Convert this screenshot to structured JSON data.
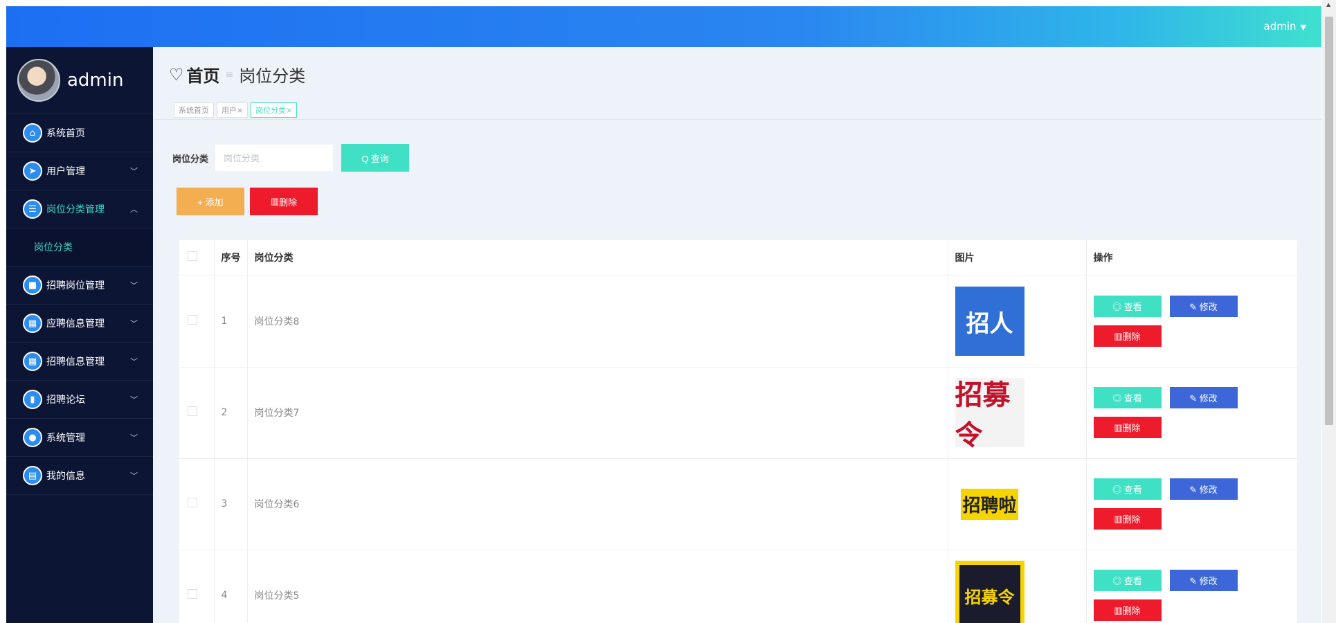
{
  "topbar": {
    "user": "admin"
  },
  "sidebar": {
    "brand": "admin",
    "items": [
      {
        "label": "系统首页",
        "icon": "home-icon",
        "glyph": "⌂",
        "arrow": ""
      },
      {
        "label": "用户管理",
        "icon": "send-icon",
        "glyph": "➤",
        "arrow": "﹀"
      },
      {
        "label": "岗位分类管理",
        "icon": "list-icon",
        "glyph": "☰",
        "arrow": "︿"
      },
      {
        "label": "招聘岗位管理",
        "icon": "briefcase-icon",
        "glyph": "■",
        "arrow": "﹀"
      },
      {
        "label": "应聘信息管理",
        "icon": "grid-icon",
        "glyph": "▦",
        "arrow": "﹀"
      },
      {
        "label": "招聘信息管理",
        "icon": "grid-icon",
        "glyph": "▦",
        "arrow": "﹀"
      },
      {
        "label": "招聘论坛",
        "icon": "chart-icon",
        "glyph": "▮",
        "arrow": "﹀"
      },
      {
        "label": "系统管理",
        "icon": "user-icon",
        "glyph": "●",
        "arrow": "﹀"
      },
      {
        "label": "我的信息",
        "icon": "card-icon",
        "glyph": "▤",
        "arrow": "﹀"
      }
    ],
    "submenu": "岗位分类"
  },
  "header": {
    "home": "首页",
    "separator": "≡",
    "current": "岗位分类",
    "tabs": [
      "系统首页",
      "用户×",
      "岗位分类×"
    ]
  },
  "search": {
    "label": "岗位分类",
    "placeholder": "岗位分类",
    "button": "Q 查询"
  },
  "actions": {
    "add": "+ 添加",
    "delete": "删除"
  },
  "table": {
    "headers": {
      "no": "序号",
      "name": "岗位分类",
      "image": "图片",
      "ops": "操作"
    },
    "rows": [
      {
        "no": "1",
        "name": "岗位分类8",
        "image_text": "招人"
      },
      {
        "no": "2",
        "name": "岗位分类7",
        "image_text": "招募令"
      },
      {
        "no": "3",
        "name": "岗位分类6",
        "image_text": "招聘啦"
      },
      {
        "no": "4",
        "name": "岗位分类5",
        "image_text": "招募令"
      }
    ],
    "view": "◎ 查看",
    "edit": "✎ 修改",
    "remove": "删除"
  }
}
